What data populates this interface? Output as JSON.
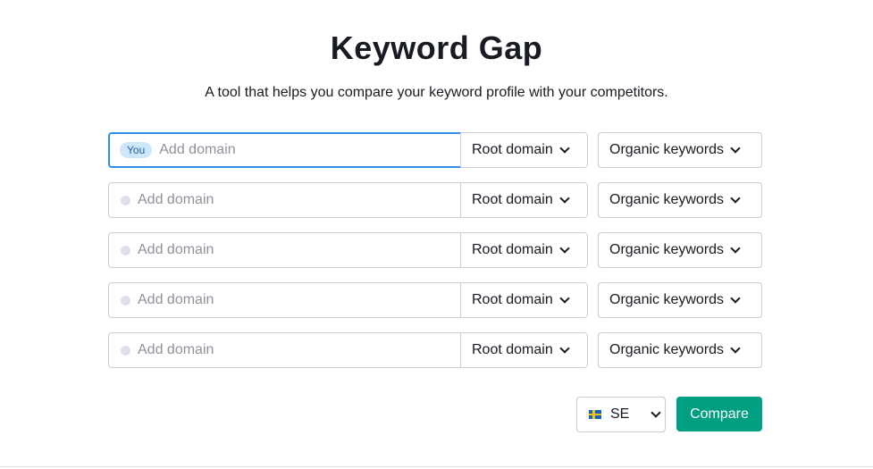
{
  "header": {
    "title": "Keyword Gap",
    "subtitle": "A tool that helps you compare your keyword profile with your competitors."
  },
  "rows": [
    {
      "badge": "You",
      "placeholder": "Add domain",
      "value": "",
      "scope": "Root domain",
      "keyword_type": "Organic keywords"
    },
    {
      "placeholder": "Add domain",
      "value": "",
      "scope": "Root domain",
      "keyword_type": "Organic keywords"
    },
    {
      "placeholder": "Add domain",
      "value": "",
      "scope": "Root domain",
      "keyword_type": "Organic keywords"
    },
    {
      "placeholder": "Add domain",
      "value": "",
      "scope": "Root domain",
      "keyword_type": "Organic keywords"
    },
    {
      "placeholder": "Add domain",
      "value": "",
      "scope": "Root domain",
      "keyword_type": "Organic keywords"
    }
  ],
  "database": {
    "flag_icon": "sweden-flag-icon",
    "code": "SE"
  },
  "actions": {
    "compare_label": "Compare"
  },
  "colors": {
    "accent": "#009f81",
    "active_border": "#2f8ee5",
    "you_badge_bg": "#cfe7fb",
    "border": "#c8ccd5"
  }
}
